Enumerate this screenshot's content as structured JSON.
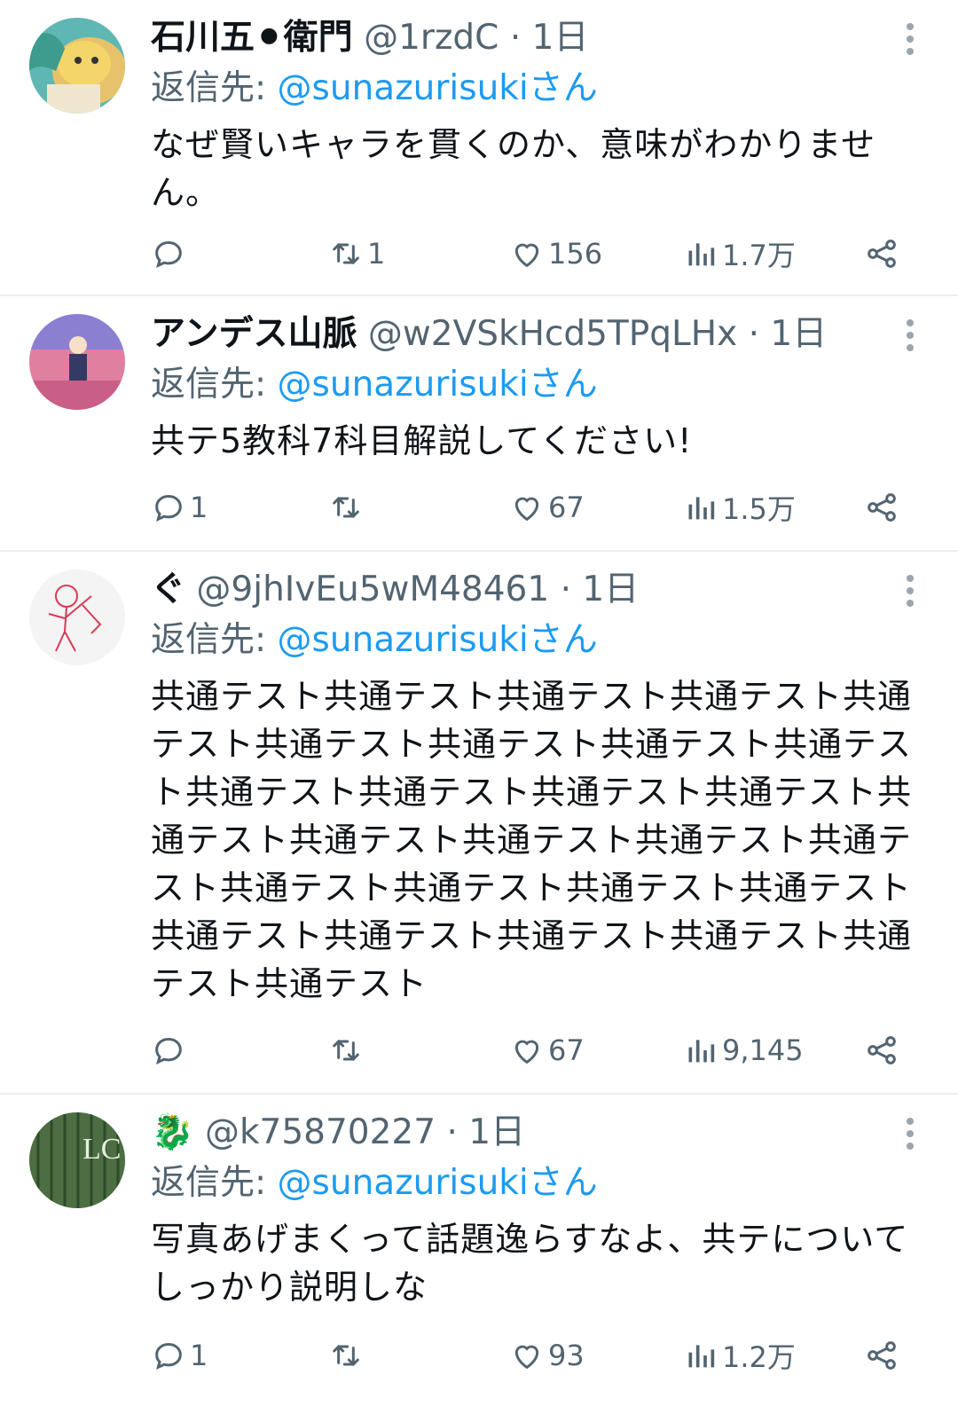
{
  "tweets": [
    {
      "name": "石川五⚫衛門",
      "handle": "@1rzdC",
      "time": "1日",
      "reply_prefix": "返信先: ",
      "reply_to": "@sunazurisukiさん",
      "text": "なぜ賢いキャラを貫くのか、意味がわかりません。",
      "replies": "",
      "retweets": "1",
      "likes": "156",
      "views": "1.7万"
    },
    {
      "name": "アンデス山脈",
      "handle": "@w2VSkHcd5TPqLHx",
      "time": "1日",
      "reply_prefix": "返信先: ",
      "reply_to": "@sunazurisukiさん",
      "text": "共テ5教科7科目解説してください!",
      "replies": "1",
      "retweets": "",
      "likes": "67",
      "views": "1.5万"
    },
    {
      "name": "ぐ",
      "handle": "@9jhIvEu5wM48461",
      "time": "1日",
      "reply_prefix": "返信先: ",
      "reply_to": "@sunazurisukiさん",
      "text": "共通テスト共通テスト共通テスト共通テスト共通テスト共通テスト共通テスト共通テスト共通テスト共通テスト共通テスト共通テスト共通テスト共通テスト共通テスト共通テスト共通テスト共通テスト共通テスト共通テスト共通テスト共通テスト共通テスト共通テスト共通テスト共通テスト共通テスト共通テスト",
      "replies": "",
      "retweets": "",
      "likes": "67",
      "views": "9,145"
    },
    {
      "name": "🐉",
      "handle": "@k75870227",
      "time": "1日",
      "reply_prefix": "返信先: ",
      "reply_to": "@sunazurisukiさん",
      "text": "写真あげまくって話題逸らすなよ、共テについてしっかり説明しな",
      "replies": "1",
      "retweets": "",
      "likes": "93",
      "views": "1.2万"
    }
  ],
  "colors": {
    "link": "#1d9bf0",
    "muted": "#536471",
    "divider": "#eceff1"
  },
  "icons": [
    "reply-icon",
    "retweet-icon",
    "like-icon",
    "views-icon",
    "share-icon",
    "more-icon"
  ]
}
